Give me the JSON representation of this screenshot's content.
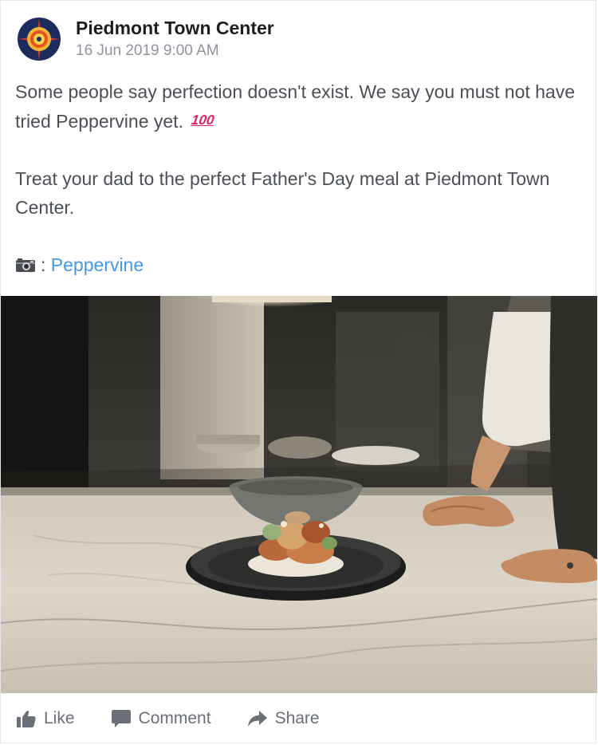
{
  "post": {
    "author": "Piedmont Town Center",
    "timestamp": "16 Jun 2019 9:00 AM",
    "paragraph1": "Some people say perfection doesn't exist. We say you must not have tried Peppervine yet.",
    "emoji": "100",
    "paragraph2": "Treat your dad to the perfect Father's Day meal at Piedmont Town Center.",
    "credit_separator": ":",
    "credit_link": "Peppervine",
    "icons": {
      "avatar": "compass-rose-logo",
      "camera": "camera-icon",
      "emoji": "hundred-points-icon"
    }
  },
  "actions": {
    "like": "Like",
    "comment": "Comment",
    "share": "Share"
  },
  "colors": {
    "link": "#4598e8",
    "muted": "#90949c",
    "text": "#4b4f56",
    "action": "#6a6f78"
  }
}
